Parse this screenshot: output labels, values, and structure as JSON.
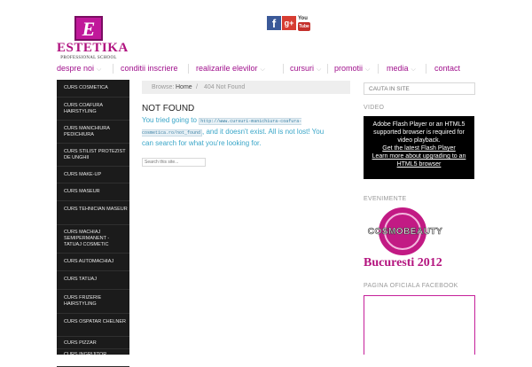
{
  "brand": {
    "letter": "E",
    "name": "ESTETIKA",
    "tagline": "PROFESSIONAL SCHOOL",
    "accent_color": "#a0108c"
  },
  "social": {
    "facebook_glyph": "f",
    "googleplus_glyph": "g+",
    "youtube_top": "You",
    "youtube_bottom": "Tube"
  },
  "nav": {
    "items": [
      {
        "label": "despre noi",
        "has_dropdown": true
      },
      {
        "label": "conditii inscriere",
        "has_dropdown": false
      },
      {
        "label": "realizarile elevilor",
        "has_dropdown": true
      },
      {
        "label": "cursuri",
        "has_dropdown": true
      },
      {
        "label": "promotii",
        "has_dropdown": true
      },
      {
        "label": "media",
        "has_dropdown": true
      },
      {
        "label": "contact",
        "has_dropdown": false
      }
    ],
    "chevron": "⌵"
  },
  "sidebar": {
    "items": [
      {
        "label": "CURS COSMETICA"
      },
      {
        "label": "CURS COAFURA HAIRSTYLING"
      },
      {
        "label": "CURS MANICHIURA PEDICHIURA"
      },
      {
        "label": "CURS STILIST PROTEZIST DE UNGHII"
      },
      {
        "label": "CURS MAKE-UP"
      },
      {
        "label": "CURS MASEUR"
      },
      {
        "label": "CURS TEHNICIAN MASEUR"
      },
      {
        "label": "CURS MACHIAJ SEMIPERMANENT - TATUAJ COSMETIC"
      },
      {
        "label": "CURS AUTOMACHIAJ"
      },
      {
        "label": "CURS TATUAJ"
      },
      {
        "label": "CURS FRIZERIE HAIRSTYLING"
      },
      {
        "label": "CURS OSPATAR CHELNER"
      },
      {
        "label": "CURS PIZZAR"
      },
      {
        "label": "CURS INGRIJITOR"
      }
    ]
  },
  "breadcrumb": {
    "prefix": "Browse:",
    "home": "Home",
    "separator": "/",
    "current": "404 Not Found"
  },
  "main": {
    "title": "NOT FOUND",
    "msg_before": "You tried going to ",
    "url": "http://www.cursuri-manichiura-coafura-cosmetica.ro/not_found",
    "msg_after": ", and it doesn't exist. All is not lost! You can search for what you're looking for.",
    "search_placeholder": "Search this site..."
  },
  "right_sidebar": {
    "search_placeholder": "CAUTA IN SITE",
    "video_title": "VIDEO",
    "video_text": "Adobe Flash Player or an HTML5 supported browser is required for video playback.",
    "video_link1": "Get the latest Flash Player",
    "video_link2": "Learn more about upgrading to an HTML5 browser",
    "events_title": "EVENIMENTE",
    "event_logo_text": "COSMOBEAUTY",
    "event_city": "Bucuresti 2012",
    "facebook_title": "PAGINA OFICIALA FACEBOOK"
  }
}
